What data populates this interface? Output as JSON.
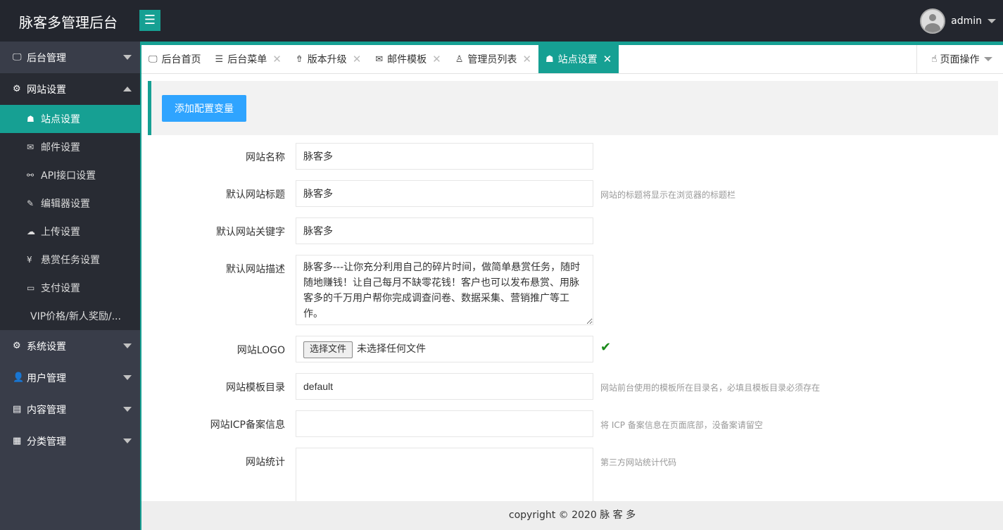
{
  "header": {
    "title": "脉客多管理后台",
    "menu_icon": "hamburger-icon",
    "user": "admin"
  },
  "sidebar": {
    "top_before": [
      {
        "label": "后台管理",
        "icon": "monitor-icon"
      },
      {
        "label": "网站设置",
        "icon": "gears-icon"
      }
    ],
    "sub": [
      {
        "label": "站点设置",
        "icon": "sitemap-icon"
      },
      {
        "label": "邮件设置",
        "icon": "mail-icon"
      },
      {
        "label": "API接口设置",
        "icon": "link-icon"
      },
      {
        "label": "编辑器设置",
        "icon": "edit-icon"
      },
      {
        "label": "上传设置",
        "icon": "cloud-upload-icon"
      },
      {
        "label": "悬赏任务设置",
        "icon": "yen-icon"
      },
      {
        "label": "支付设置",
        "icon": "wallet-icon"
      },
      {
        "label": "VIP价格/新人奖励/..."
      }
    ],
    "top_after": [
      {
        "label": "系统设置",
        "icon": "gear-icon"
      },
      {
        "label": "用户管理",
        "icon": "user-icon"
      },
      {
        "label": "内容管理",
        "icon": "document-icon"
      },
      {
        "label": "分类管理",
        "icon": "grid-icon"
      }
    ]
  },
  "tabs": [
    {
      "label": "后台首页",
      "icon": "monitor-icon"
    },
    {
      "label": "后台菜单",
      "icon": "list-icon"
    },
    {
      "label": "版本升级",
      "icon": "upload-icon"
    },
    {
      "label": "邮件模板",
      "icon": "mail-icon"
    },
    {
      "label": "管理员列表",
      "icon": "user-icon"
    },
    {
      "label": "站点设置",
      "icon": "sitemap-icon"
    }
  ],
  "page_op": "页面操作",
  "toolbar": {
    "add_label": "添加配置变量"
  },
  "form": {
    "site_name": {
      "label": "网站名称",
      "value": "脉客多"
    },
    "title": {
      "label": "默认网站标题",
      "value": "脉客多",
      "hint": "网站的标题将显示在浏览器的标题栏"
    },
    "keywords": {
      "label": "默认网站关键字",
      "value": "脉客多"
    },
    "description": {
      "label": "默认网站描述",
      "value": "脉客多---让你充分利用自己的碎片时间，做简单悬赏任务，随时随地赚钱！让自己每月不缺零花钱！客户也可以发布悬赏、用脉客多的千万用户帮你完成调查问卷、数据采集、营销推广等工作。"
    },
    "logo": {
      "label": "网站LOGO",
      "button": "选择文件",
      "status": "未选择任何文件"
    },
    "template": {
      "label": "网站模板目录",
      "value": "default",
      "hint": "网站前台使用的模板所在目录名，必填且模板目录必须存在"
    },
    "icp": {
      "label": "网站ICP备案信息",
      "value": "",
      "hint": "将 ICP 备案信息在页面底部，没备案请留空"
    },
    "stats": {
      "label": "网站统计",
      "value": "",
      "hint": "第三方网站统计代码"
    }
  },
  "footer": "copyright © 2020 脉 客 多",
  "colors": {
    "accent": "#16a093",
    "button": "#2fa4ff",
    "sidebar": "#393d49",
    "header": "#23262e"
  }
}
